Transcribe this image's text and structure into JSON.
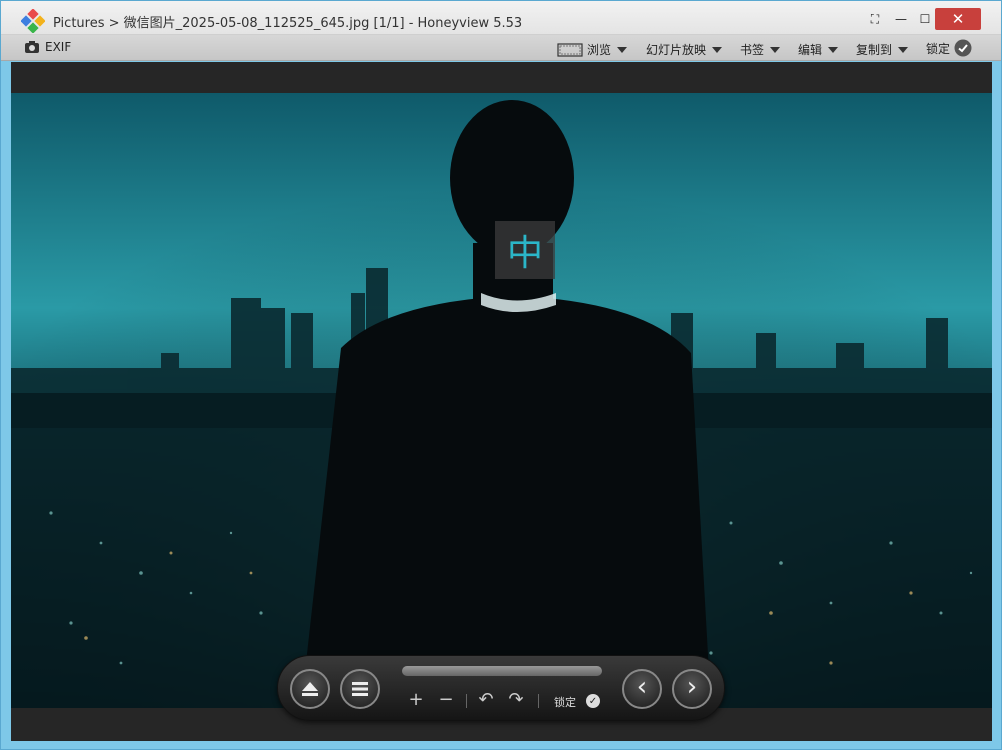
{
  "window": {
    "title": "Pictures > 微信图片_2025-05-08_112525_645.jpg [1/1] - Honeyview 5.53",
    "close_glyph": "✕",
    "max_glyph": "☐",
    "min_glyph": "—",
    "fullscreen_glyph": "⛶"
  },
  "toolbar": {
    "exif_label": "EXIF",
    "browse_label": "浏览",
    "slideshow_label": "幻灯片放映",
    "bookmark_label": "书签",
    "edit_label": "编辑",
    "copy_to_label": "复制到",
    "lock_label": "锁定"
  },
  "viewer": {
    "ime_indicator": "中",
    "image_description": "man in suit overlooking city at night"
  },
  "controls": {
    "lock_label": "锁定",
    "zoom_in_glyph": "+",
    "zoom_out_glyph": "−",
    "rotate_left_glyph": "↶",
    "rotate_right_glyph": "↷",
    "prev_glyph": "‹",
    "next_glyph": "›",
    "check_glyph": "✓"
  },
  "colors": {
    "close_button": "#c8403c",
    "ime_accent": "#2bb6c8",
    "photo_teal": "#0b3940"
  }
}
